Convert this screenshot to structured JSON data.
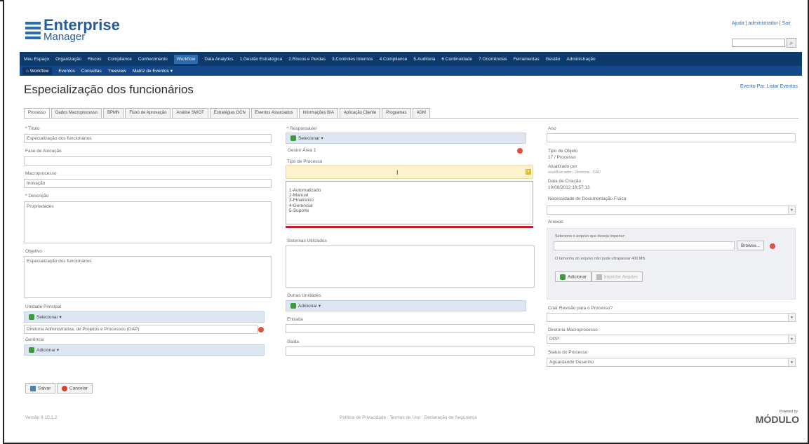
{
  "header": {
    "logo_line1": "Enterprise",
    "logo_line2": "Manager",
    "top_links": "Ajuda | administrador | Sair"
  },
  "nav_main": [
    "Meu Espaço",
    "Organização",
    "Riscos",
    "Compliance",
    "Conhecimento",
    "Workflow",
    "Data Analytics",
    "1.Gestão Estratégica",
    "2.Riscos e Perdas",
    "3.Controles Internos",
    "4.Compliance",
    "5.Auditoria",
    "6.Continuidade",
    "7.Ocorrências",
    "Ferramentas",
    "Gestão",
    "Administração"
  ],
  "nav_sub": {
    "home": "Workflow",
    "items": [
      "Eventos",
      "Consultas",
      "Treeview",
      "Matriz de Eventos ▾"
    ]
  },
  "page": {
    "title": "Especialização dos funcionários",
    "top_right_link": "Evento Pai: Listar Eventos"
  },
  "tabs": [
    "Processo",
    "Dados Macroprocesso",
    "BPMN",
    "Fluxo de Aprovação",
    "Análise SWOT",
    "Estratégias GCN",
    "Eventos Associados",
    "Informações BIA",
    "Aplicação Cliente",
    "Programas",
    "ADM"
  ],
  "left": {
    "titulo_label": "* Título",
    "titulo_value": "Especialização dos funcionários",
    "fase_label": "Fase de Alocação",
    "fase_value": "",
    "macro_label": "Macroprocesso",
    "macro_value": "Inovação",
    "descricao_label": "* Descrição",
    "descricao_value": "Propriedades",
    "objetivo_label": "Objetivo",
    "objetivo_value": "Especialização dos funcionários",
    "unidade_label": "Unidade Principal",
    "unidade_btn": "Selecionar ▾",
    "unidade_value": "Diretoria Administrativa, de Projetos e Processos (DAP)",
    "gerencia_label": "Gerência",
    "gerencia_btn": "Adicionar ▾"
  },
  "middle": {
    "responsavel_label": "* Responsável",
    "responsavel_btn": "Selecionar ▾",
    "responsavel_value": "Gestor Área 1",
    "tipo_label": "Tipo de Processo",
    "tipo_options": [
      "1-Automatizado",
      "2-Manual",
      "3-Finalístico",
      "4-Gerencial",
      "5-Suporte"
    ],
    "sistemas_label": "Sistemas Utilizados",
    "outras_label": "Outras Unidades",
    "outras_btn": "Adicionar ▾",
    "entrada_label": "Entrada",
    "saida_label": "Saída"
  },
  "right": {
    "ano_label": "Ano",
    "ano_value": "",
    "tipo_objeto_label": "Tipo de Objeto",
    "tipo_objeto_value": "17 / Processo",
    "atualizado_label": "Atualizado por",
    "atualizado_value": "workflow.adm - Diretoria - DAP",
    "data_label": "Data de Criação",
    "data_value": "10/08/2012 16:57:13",
    "necessidade_label": "Necessidade de Documentação Física",
    "anexos_label": "Anexos",
    "anexos_hint": "Selecione o arquivo que deseja importar:",
    "browse": "Browse...",
    "anexos_size": "O tamanho do arquivo não pode ultrapassar 400 MB.",
    "adicionar": "Adicionar",
    "importar": "Importar Arquivo",
    "criar_label": "Criar Revisão para o Processo?",
    "diretoria_label": "Diretoria Macroprocesso",
    "diretoria_value": "DPP",
    "status_label": "Status do Processo",
    "status_value": "Aguardando Desenho"
  },
  "buttons": {
    "salvar": "Salvar",
    "cancelar": "Cancelar"
  },
  "footer": {
    "version": "Versão 9.10.1.2",
    "links": "Política de Privacidade : Termos de Uso : Declaração de Segurança",
    "brand": "MÓDULO",
    "powered": "Powered by"
  }
}
